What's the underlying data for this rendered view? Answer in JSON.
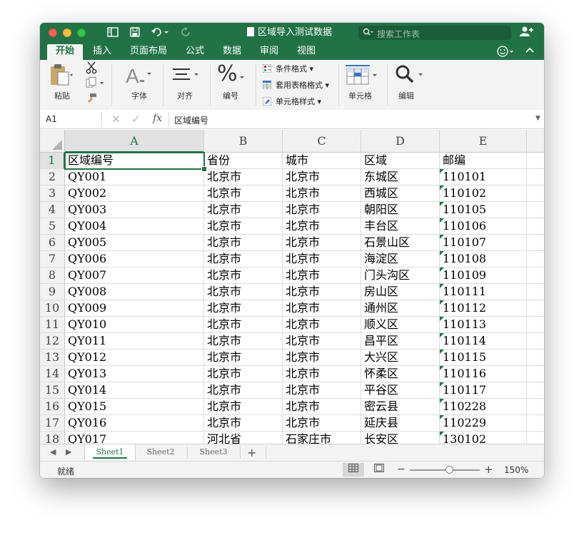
{
  "window": {
    "title": "区域导入测试数据"
  },
  "search": {
    "placeholder": "搜索工作表"
  },
  "tabs": [
    "开始",
    "插入",
    "页面布局",
    "公式",
    "数据",
    "审阅",
    "视图"
  ],
  "ribbon": {
    "paste": "粘贴",
    "font": "字体",
    "align": "对齐",
    "number": "编号",
    "percent_glyph": "%",
    "conditional_format": "条件格式",
    "table_format": "套用表格格式",
    "cell_styles": "单元格样式",
    "cells": "单元格",
    "editing": "编辑"
  },
  "formula_bar": {
    "name_box": "A1",
    "fx": "fx",
    "value": "区域编号"
  },
  "grid": {
    "columns": [
      "A",
      "B",
      "C",
      "D",
      "E"
    ],
    "rows": [
      [
        "区域编号",
        "省份",
        "城市",
        "区域",
        "邮编"
      ],
      [
        "QY001",
        "北京市",
        "北京市",
        "东城区",
        "110101"
      ],
      [
        "QY002",
        "北京市",
        "北京市",
        "西城区",
        "110102"
      ],
      [
        "QY003",
        "北京市",
        "北京市",
        "朝阳区",
        "110105"
      ],
      [
        "QY004",
        "北京市",
        "北京市",
        "丰台区",
        "110106"
      ],
      [
        "QY005",
        "北京市",
        "北京市",
        "石景山区",
        "110107"
      ],
      [
        "QY006",
        "北京市",
        "北京市",
        "海淀区",
        "110108"
      ],
      [
        "QY007",
        "北京市",
        "北京市",
        "门头沟区",
        "110109"
      ],
      [
        "QY008",
        "北京市",
        "北京市",
        "房山区",
        "110111"
      ],
      [
        "QY009",
        "北京市",
        "北京市",
        "通州区",
        "110112"
      ],
      [
        "QY010",
        "北京市",
        "北京市",
        "顺义区",
        "110113"
      ],
      [
        "QY011",
        "北京市",
        "北京市",
        "昌平区",
        "110114"
      ],
      [
        "QY012",
        "北京市",
        "北京市",
        "大兴区",
        "110115"
      ],
      [
        "QY013",
        "北京市",
        "北京市",
        "怀柔区",
        "110116"
      ],
      [
        "QY014",
        "北京市",
        "北京市",
        "平谷区",
        "110117"
      ],
      [
        "QY015",
        "北京市",
        "北京市",
        "密云县",
        "110228"
      ],
      [
        "QY016",
        "北京市",
        "北京市",
        "延庆县",
        "110229"
      ],
      [
        "QY017",
        "河北省",
        "石家庄市",
        "长安区",
        "130102"
      ]
    ]
  },
  "sheets": [
    "Sheet1",
    "Sheet2",
    "Sheet3"
  ],
  "status": {
    "text": "就绪",
    "zoom": "150%"
  },
  "colors": {
    "accent": "#217346",
    "ribbon_bg": "#f3f3f3"
  }
}
